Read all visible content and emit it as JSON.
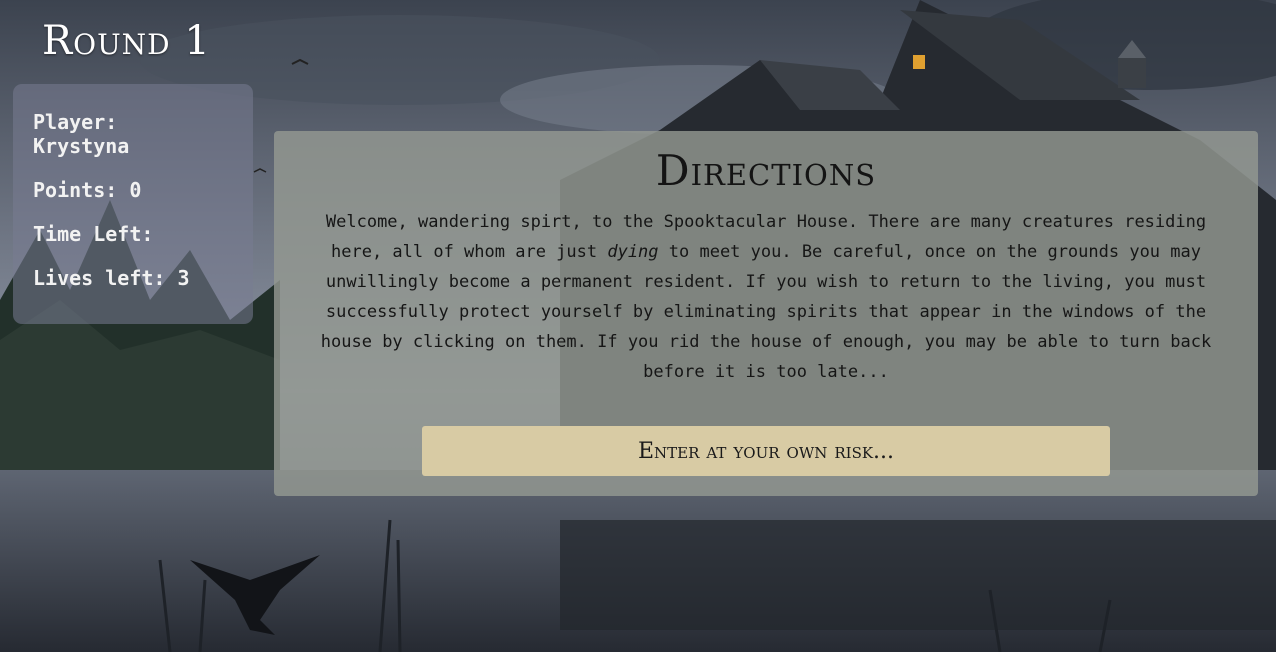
{
  "round": {
    "title": "Round 1"
  },
  "stats": {
    "player_label": "Player:",
    "player_name": "Krystyna",
    "points_label": "Points:",
    "points_value": "0",
    "time_label": "Time Left:",
    "time_value": "",
    "lives_label": "Lives left:",
    "lives_value": "3"
  },
  "directions": {
    "heading": "Directions",
    "text_before": "Welcome, wandering spirt, to the Spooktacular House. There are many creatures residing here, all of whom are just ",
    "text_emphasis": "dying",
    "text_after": " to meet you. Be careful, once on the grounds you may unwillingly become a permanent resident. If you wish to return to the living, you must successfully protect yourself by eliminating spirits that appear in the windows of the house by clicking on them. If you rid the house of enough, you may be able to turn back before it is too late...",
    "button_label": "Enter at your own risk..."
  },
  "colors": {
    "button_bg": "#d8cba4",
    "panel_bg": "#949891",
    "stats_bg": "#787c91"
  }
}
